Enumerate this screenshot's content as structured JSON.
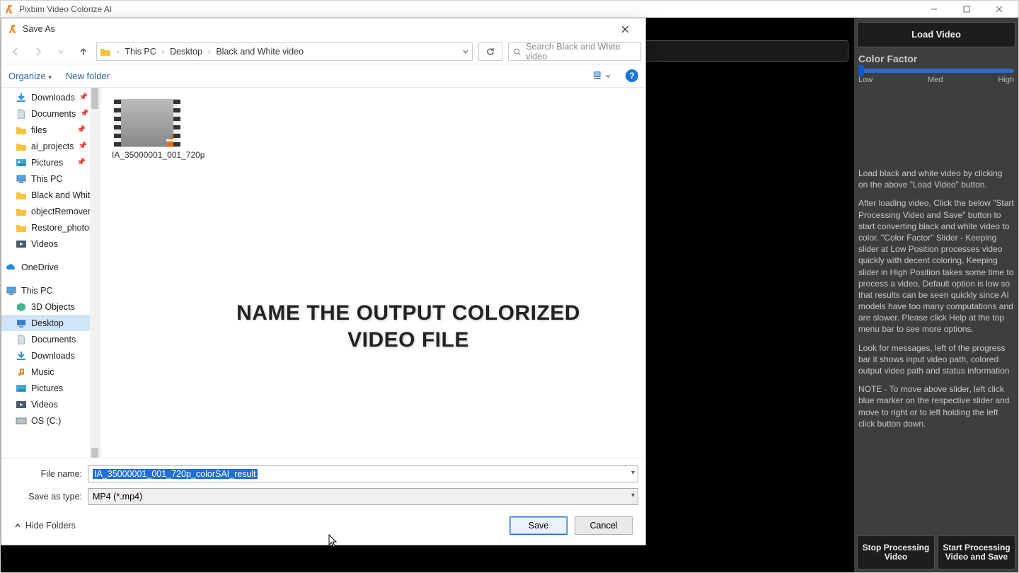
{
  "app": {
    "title": "Pixbim Video Colorize AI"
  },
  "right_panel": {
    "load_video": "Load Video",
    "section": "Color Factor",
    "slider": {
      "low": "Low",
      "med": "Med",
      "high": "High"
    },
    "para1": "Load black and white video by clicking on the above \"Load Video\" button.",
    "para2": "After loading video, Click the below \"Start Processing Video and Save\" button to start converting black and white video to color. \"Color Factor\" Slider - Keeping slider at Low Position processes video quickly with decent coloring, Keeping slider in High Position takes some time to process a video, Default option is low so that results can be seen quickly since AI models have too many computations and are slower. Please click Help at the top menu bar to see more options.",
    "para3": "Look for messages, left of the progress bar it shows input video path, colored output video path and status information",
    "para4": "NOTE - To move above slider, left click blue marker on the respective slider and move to right or to left holding the left click button down.",
    "stop": "Stop Processing Video",
    "start": "Start Processing Video and Save"
  },
  "dialog": {
    "title": "Save As",
    "breadcrumb": {
      "pc": "This PC",
      "desktop": "Desktop",
      "folder": "Black and White video"
    },
    "search_placeholder": "Search Black and White video",
    "organize": "Organize",
    "new_folder": "New folder",
    "help": "?",
    "tree_quick": {
      "downloads": "Downloads",
      "documents": "Documents",
      "files": "files",
      "ai_projects": "ai_projects",
      "pictures": "Pictures",
      "this_pc": "This PC",
      "bw": "Black and White",
      "objrem": "objectRemoverS",
      "restore": "Restore_photos",
      "videos": "Videos"
    },
    "onedrive": "OneDrive",
    "this_pc": "This PC",
    "pc_children": {
      "objects3d": "3D Objects",
      "desktop": "Desktop",
      "documents": "Documents",
      "downloads": "Downloads",
      "music": "Music",
      "pictures": "Pictures",
      "videos": "Videos",
      "osc": "OS (C:)"
    },
    "file_item": "IA_35000001_001_720p",
    "overlay_line1": "NAME THE OUTPUT COLORIZED",
    "overlay_line2": "VIDEO FILE",
    "filename_label": "File name:",
    "filename_value": "IA_35000001_001_720p_colorSAI_result",
    "type_label": "Save as type:",
    "type_value": "MP4 (*.mp4)",
    "hide_folders": "Hide Folders",
    "save": "Save",
    "cancel": "Cancel"
  }
}
